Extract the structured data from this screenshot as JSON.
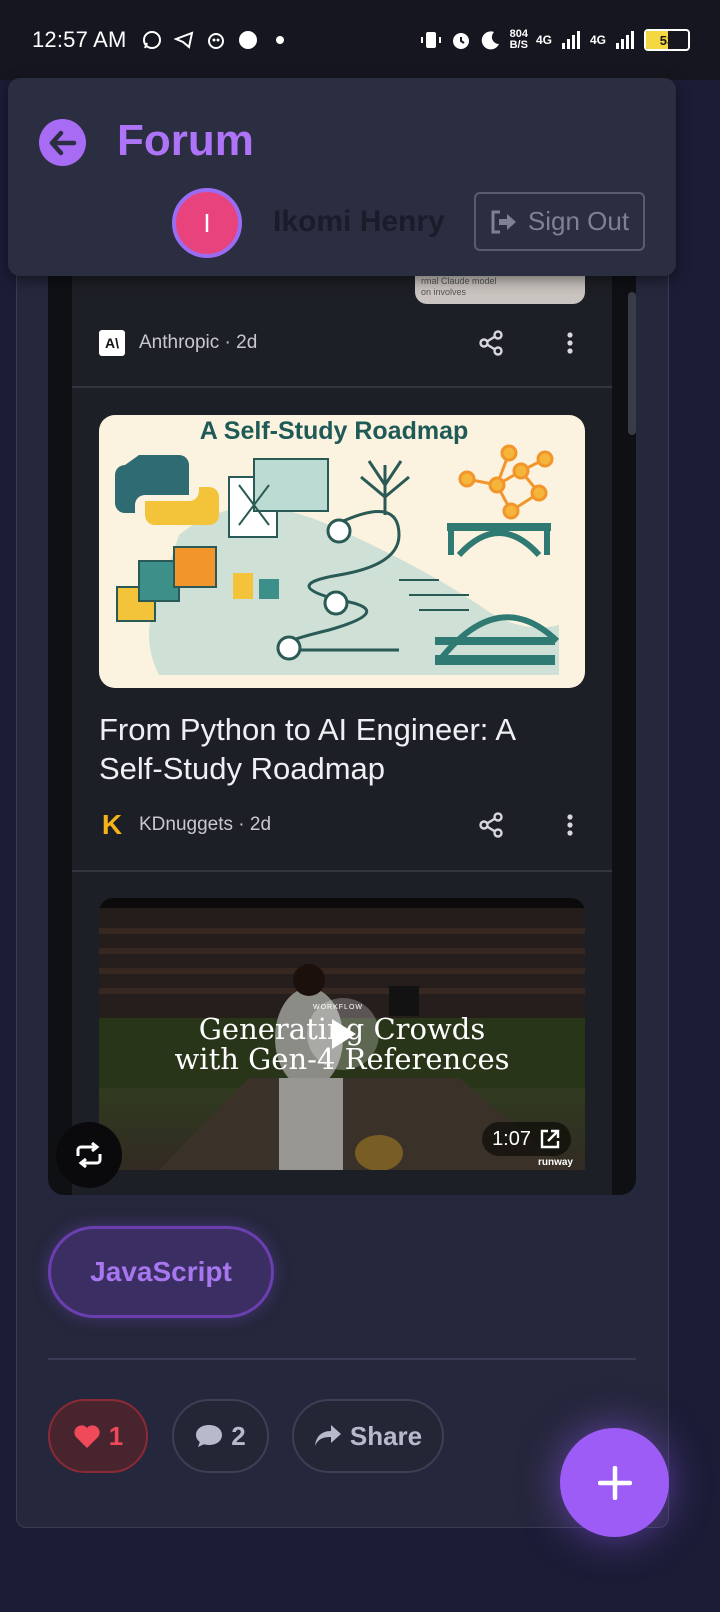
{
  "status_bar": {
    "time": "12:57 AM",
    "speed_value": "804",
    "speed_unit": "B/S",
    "network_1": "4G",
    "network_2": "4G",
    "battery_level": "53"
  },
  "header": {
    "title": "Forum",
    "avatar_initial": "I",
    "user_name": "Ikomi Henry",
    "sign_out_label": "Sign Out"
  },
  "feed": {
    "prev_snippet_line1": "rmal Claude model",
    "prev_snippet_line2": "on involves",
    "items": [
      {
        "source_logo": "A\\",
        "source": "Anthropic · 2d"
      },
      {
        "image_heading": "A Self-Study Roadmap",
        "title": "From Python to AI Engineer: A Self-Study Roadmap",
        "source_logo": "K",
        "source": "KDnuggets · 2d"
      },
      {
        "video_badge": "WORKFLOW",
        "video_title_line1": "Generating Crowds",
        "video_title_line2": "with Gen-4 References",
        "duration": "1:07",
        "brand": "runway"
      }
    ]
  },
  "post": {
    "tag": "JavaScript",
    "likes": "1",
    "comments": "2",
    "share_label": "Share"
  },
  "colors": {
    "accent": "#a76bf4",
    "like": "#f04a5a",
    "avatar": "#e9437d"
  }
}
